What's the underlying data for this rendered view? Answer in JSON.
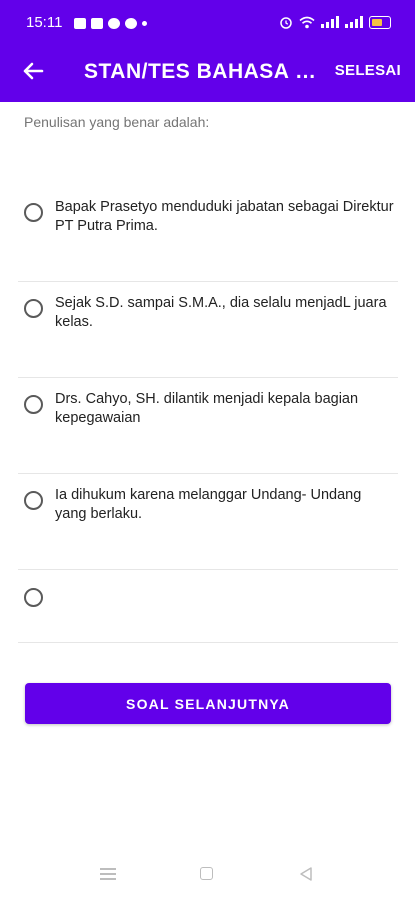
{
  "status_bar": {
    "time": "15:11"
  },
  "app_bar": {
    "title": "STAN/TES BAHASA INDONESIA",
    "done_label": "SELESAI"
  },
  "question": {
    "text": "Penulisan yang benar adalah:"
  },
  "options": [
    {
      "label": "Bapak Prasetyo menduduki jabatan sebagai Direktur PT Putra Prima."
    },
    {
      "label": "Sejak S.D. sampai S.M.A., dia selalu menjadL juara kelas."
    },
    {
      "label": "Drs. Cahyo, SH. dilantik menjadi kepala bagian kepegawaian"
    },
    {
      "label": "Ia dihukum karena melanggar Undang- Undang yang berlaku."
    },
    {
      "label": ""
    }
  ],
  "next_button": {
    "label": "SOAL SELANJUTNYA"
  },
  "colors": {
    "primary": "#6200ea"
  }
}
